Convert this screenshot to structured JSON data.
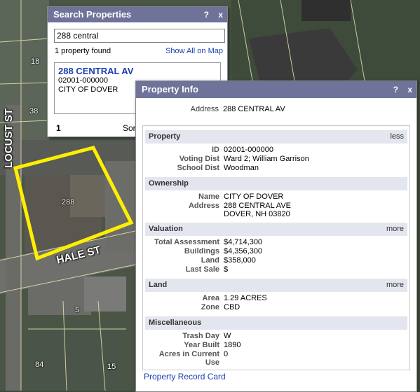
{
  "map": {
    "streets": {
      "locust": "LOCUST ST",
      "hale": "HALE ST"
    },
    "lot_numbers": [
      "18",
      "38",
      "288",
      "5",
      "84",
      "15"
    ],
    "highlight_color": "#ffee00"
  },
  "search": {
    "title": "Search Properties",
    "help": "?",
    "close": "x",
    "query": "288 central",
    "found": "1 property found",
    "show_all": "Show All on Map",
    "result": {
      "address": "288 CENTRAL AV",
      "id": "02001-000000",
      "owner": "CITY OF DOVER"
    },
    "page": "1",
    "sort": "Sor"
  },
  "info": {
    "title": "Property Info",
    "help": "?",
    "close": "x",
    "address_label": "Address",
    "address_value": "288 CENTRAL AV",
    "sections": {
      "property": {
        "title": "Property",
        "toggle": "less",
        "fields": [
          {
            "k": "ID",
            "v": "02001-000000"
          },
          {
            "k": "Voting Dist",
            "v": "Ward 2; William Garrison"
          },
          {
            "k": "School Dist",
            "v": "Woodman"
          }
        ]
      },
      "ownership": {
        "title": "Ownership",
        "fields": [
          {
            "k": "Name",
            "v": "CITY OF DOVER"
          },
          {
            "k": "Address",
            "v": "288 CENTRAL AVE"
          },
          {
            "k": "",
            "v": "DOVER, NH 03820"
          }
        ]
      },
      "valuation": {
        "title": "Valuation",
        "toggle": "more",
        "fields": [
          {
            "k": "Total Assessment",
            "v": "$4,714,300"
          },
          {
            "k": "Buildings",
            "v": "$4,356,300"
          },
          {
            "k": "Land",
            "v": "$358,000"
          },
          {
            "k": "Last Sale",
            "v": "$"
          }
        ]
      },
      "land": {
        "title": "Land",
        "toggle": "more",
        "fields": [
          {
            "k": "Area",
            "v": "1.29 ACRES"
          },
          {
            "k": "Zone",
            "v": "CBD"
          }
        ]
      },
      "misc": {
        "title": "Miscellaneous",
        "fields": [
          {
            "k": "Trash Day",
            "v": "W"
          },
          {
            "k": "Year Built",
            "v": "1890"
          },
          {
            "k": "Acres in Current",
            "v": "0"
          },
          {
            "k": "Use",
            "v": ""
          }
        ]
      }
    },
    "card_link": "Property Record Card"
  }
}
